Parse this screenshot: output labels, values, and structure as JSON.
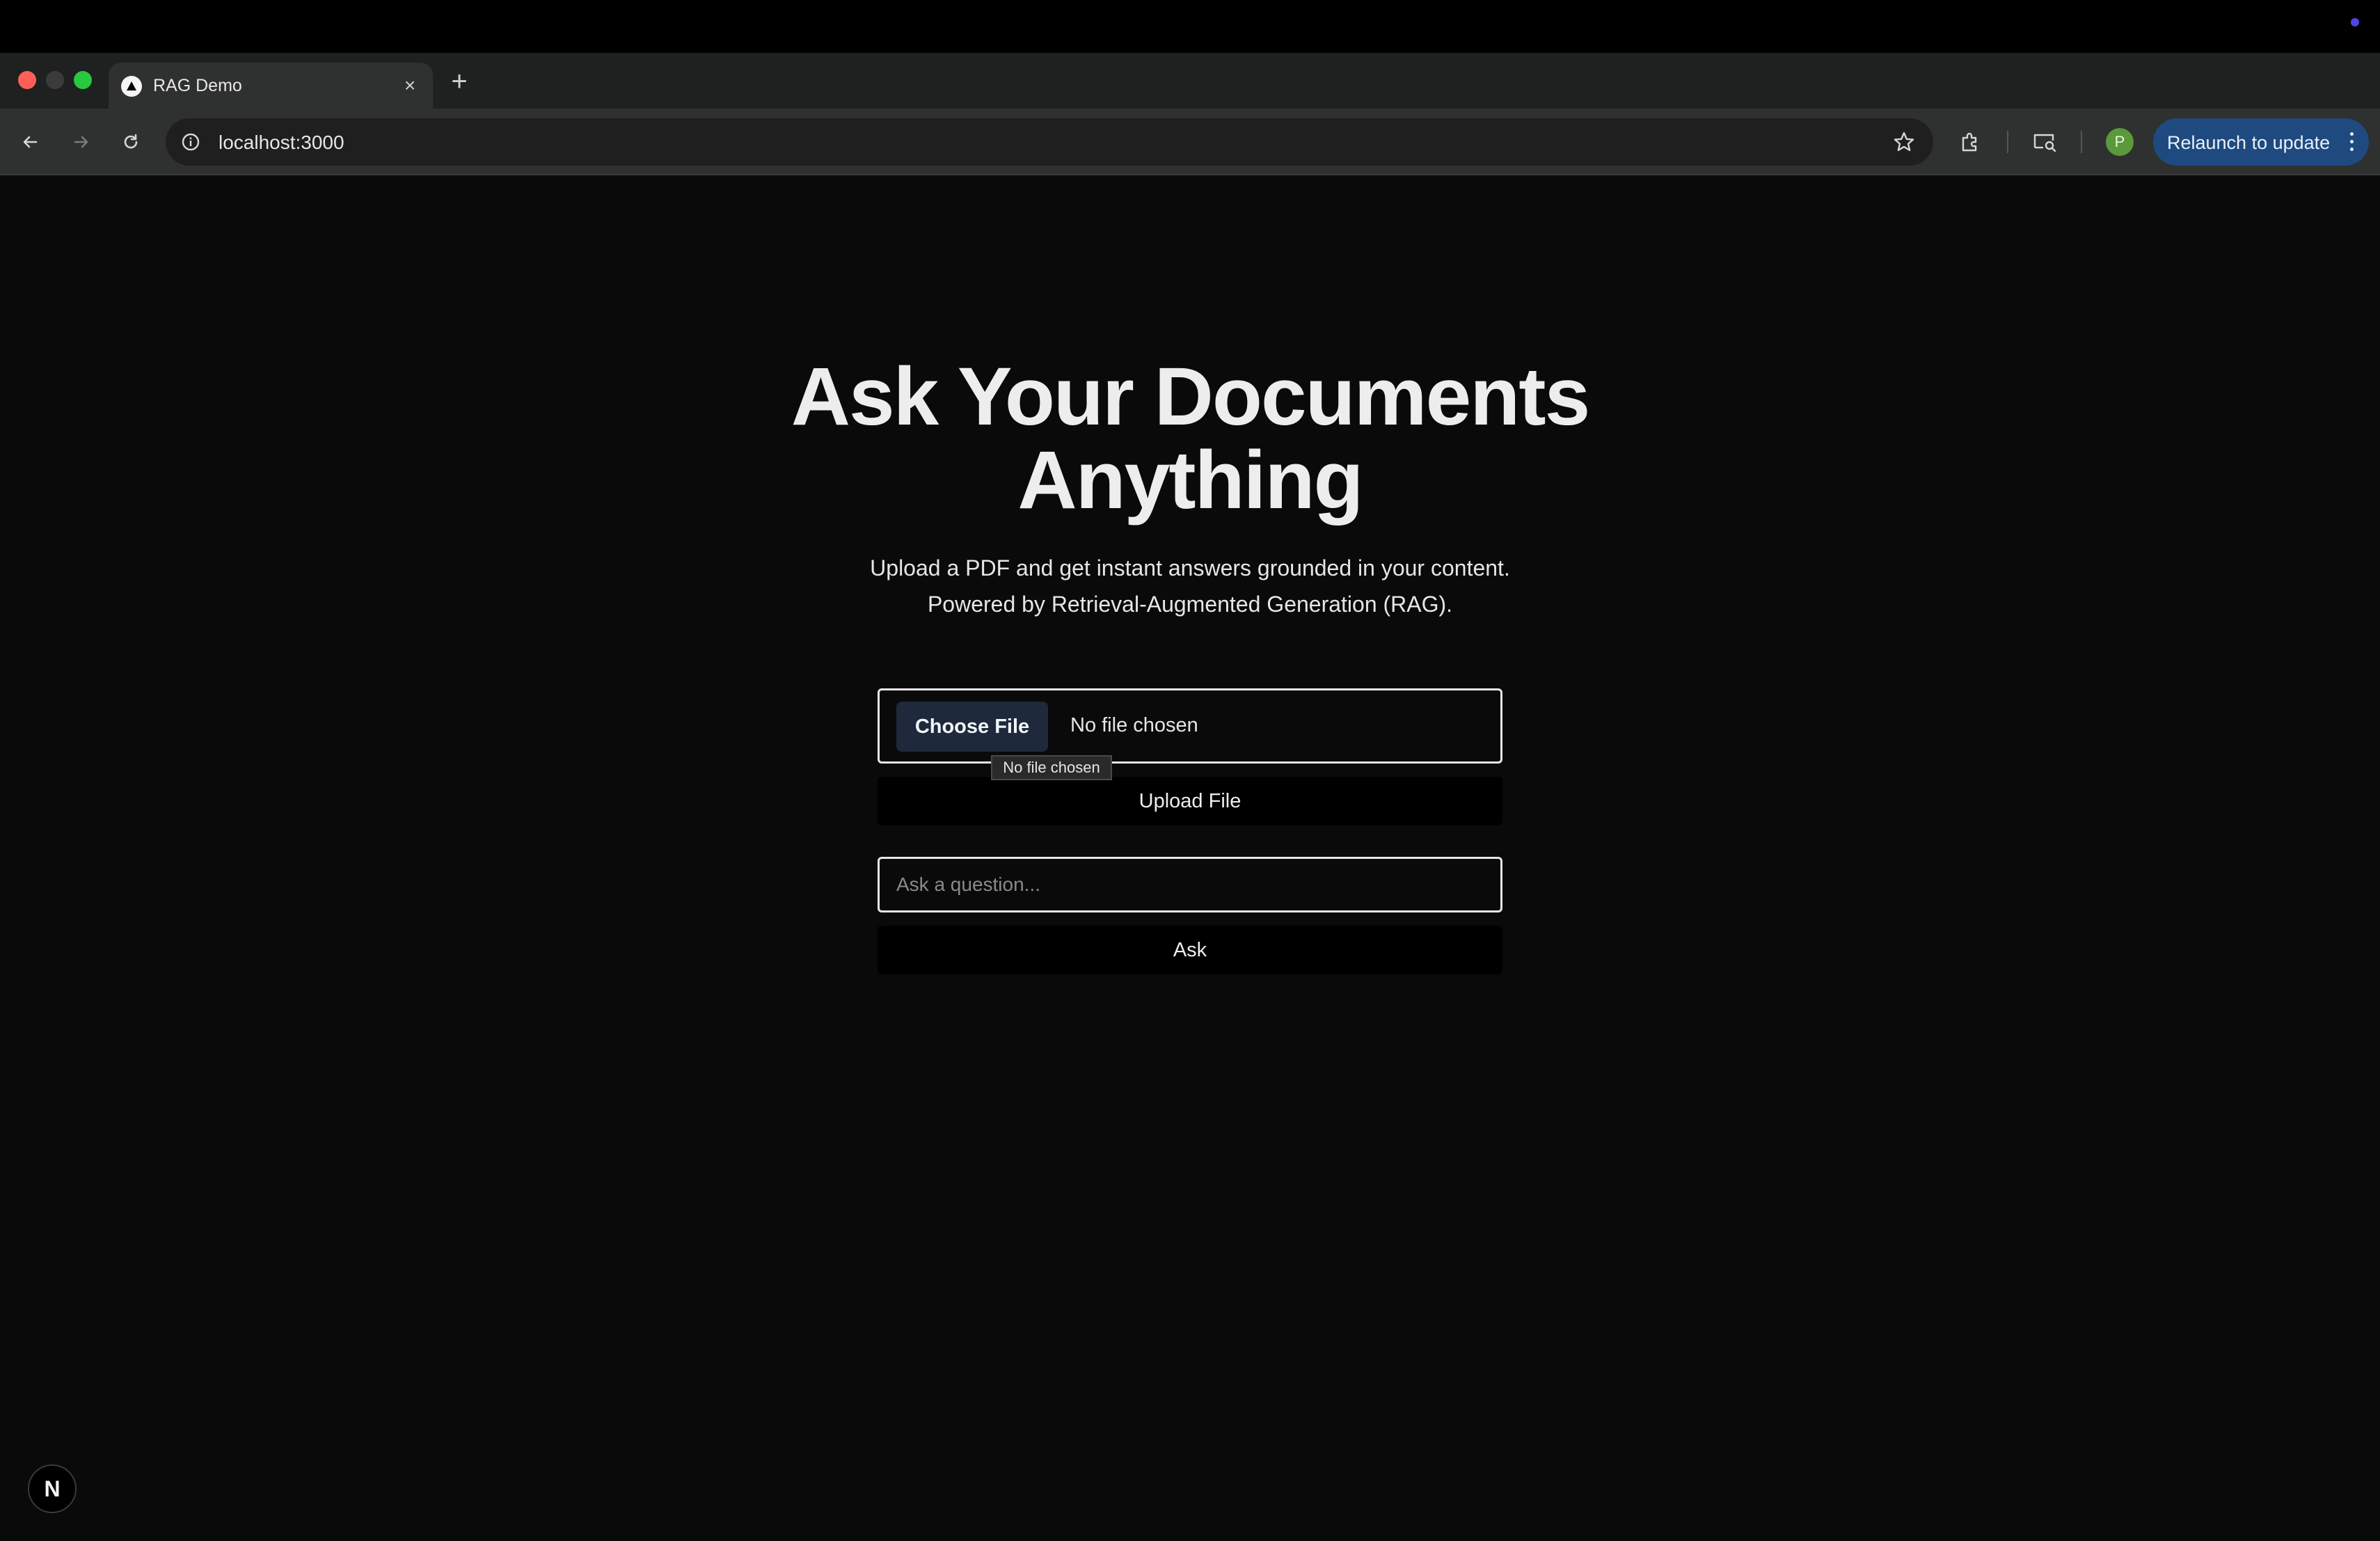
{
  "browser": {
    "tab": {
      "title": "RAG Demo",
      "close_glyph": "×",
      "favicon": "triangle-logo-icon"
    },
    "new_tab_glyph": "+",
    "address": {
      "url": "localhost:3000"
    },
    "profile_initial": "P",
    "relaunch_label": "Relaunch to update",
    "colors": {
      "accent": "#1e4a80",
      "avatar": "#5a9a3a"
    }
  },
  "hero": {
    "title_line1": "Ask Your Documents",
    "title_line2": "Anything",
    "subtitle_line1": "Upload a PDF and get instant answers grounded in your content.",
    "subtitle_line2": "Powered by Retrieval-Augmented Generation (RAG)."
  },
  "upload": {
    "choose_label": "Choose File",
    "no_file_text": "No file chosen",
    "tooltip": "No file chosen",
    "button_label": "Upload File"
  },
  "ask": {
    "placeholder": "Ask a question...",
    "value": "",
    "button_label": "Ask"
  },
  "dev_badge": {
    "letter": "N"
  }
}
